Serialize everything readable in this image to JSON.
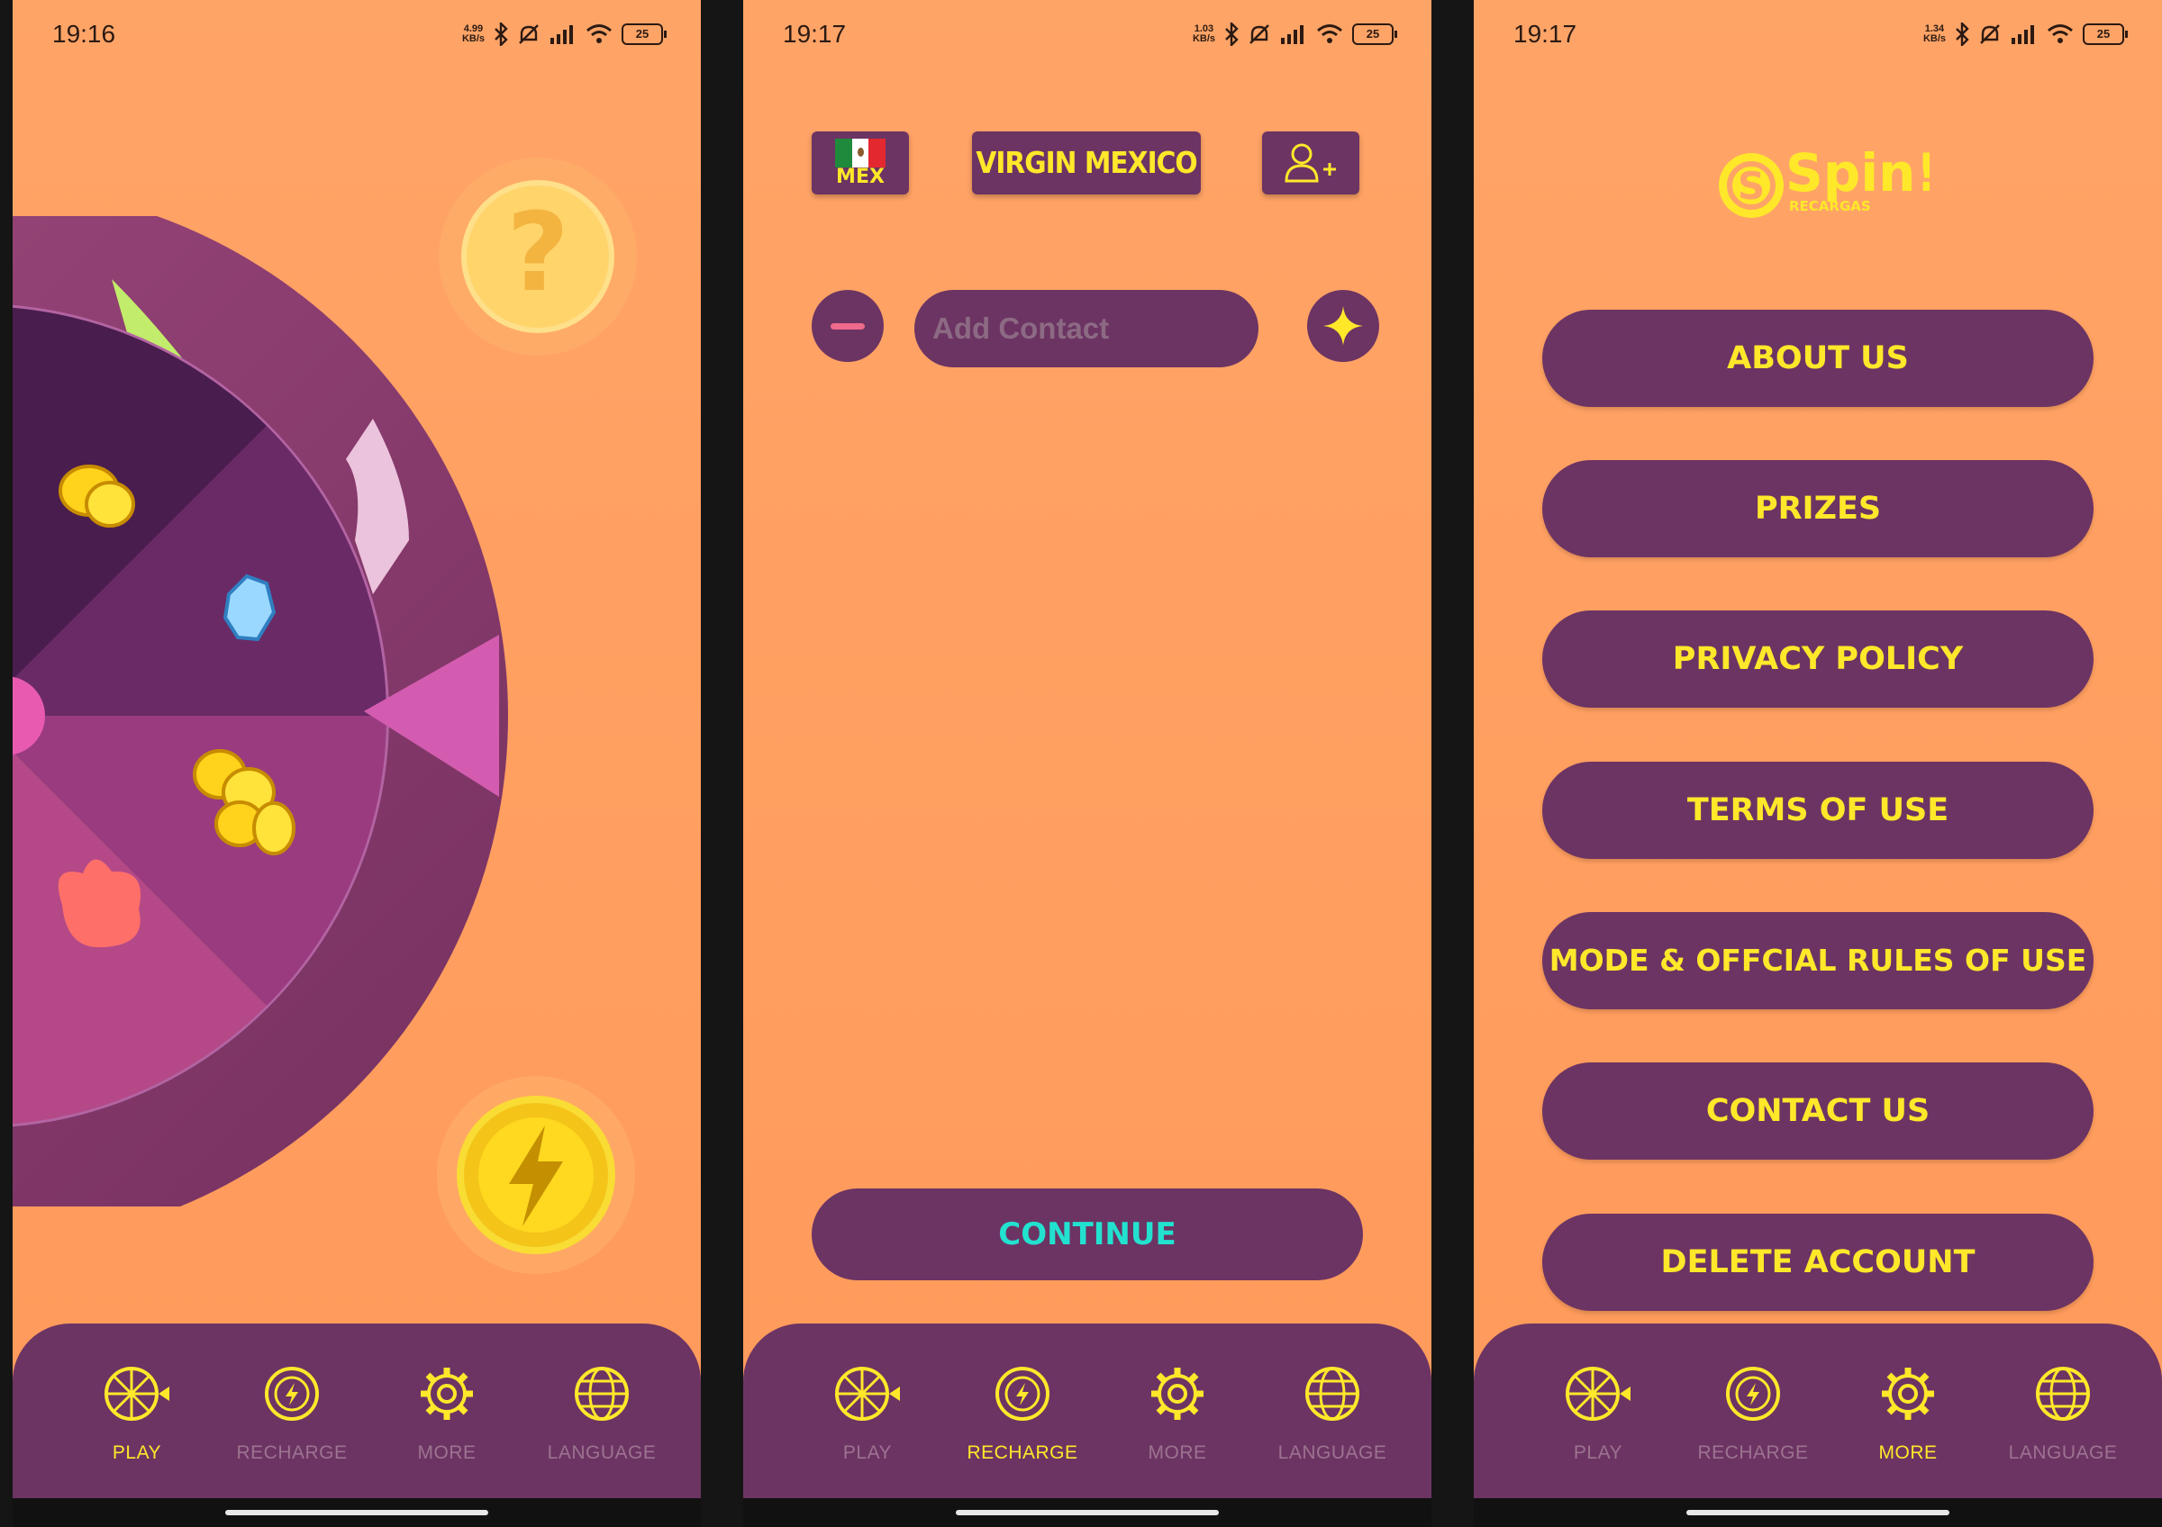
{
  "screens": [
    {
      "status": {
        "time": "19:16",
        "speed": "4.99",
        "speed_unit": "KB/s",
        "battery": "25"
      },
      "nav": [
        {
          "label": "PLAY",
          "active": true
        },
        {
          "label": "RECHARGE",
          "active": false
        },
        {
          "label": "MORE",
          "active": false
        },
        {
          "label": "LANGUAGE",
          "active": false
        }
      ]
    },
    {
      "status": {
        "time": "19:17",
        "speed": "1.03",
        "speed_unit": "KB/s",
        "battery": "25"
      },
      "country_code": "MEX",
      "carrier": "VIRGIN MEXICO",
      "contact_placeholder": "Add Contact",
      "continue_label": "CONTINUE",
      "nav": [
        {
          "label": "PLAY",
          "active": false
        },
        {
          "label": "RECHARGE",
          "active": true
        },
        {
          "label": "MORE",
          "active": false
        },
        {
          "label": "LANGUAGE",
          "active": false
        }
      ]
    },
    {
      "status": {
        "time": "19:17",
        "speed": "1.34",
        "speed_unit": "KB/s",
        "battery": "25"
      },
      "logo": {
        "main": "Spin!",
        "sub": "RECARGAS"
      },
      "menu": [
        "ABOUT US",
        "PRIZES",
        "PRIVACY POLICY",
        "TERMS OF USE",
        "MODE & OFFCIAL RULES OF USE",
        "CONTACT US",
        "DELETE ACCOUNT"
      ],
      "nav": [
        {
          "label": "PLAY",
          "active": false
        },
        {
          "label": "RECHARGE",
          "active": false
        },
        {
          "label": "MORE",
          "active": true
        },
        {
          "label": "LANGUAGE",
          "active": false
        }
      ]
    }
  ],
  "colors": {
    "background": "#ffa467",
    "panel": "#6c3463",
    "accent": "#ffe82a",
    "continue": "#22e2cf",
    "inactive": "#9c7390"
  },
  "icons": {
    "play": "wheel-icon",
    "recharge": "bolt-coin-icon",
    "more": "gear-icon",
    "language": "globe-icon",
    "help": "question-coin-icon",
    "spin": "lightning-coin-icon"
  }
}
